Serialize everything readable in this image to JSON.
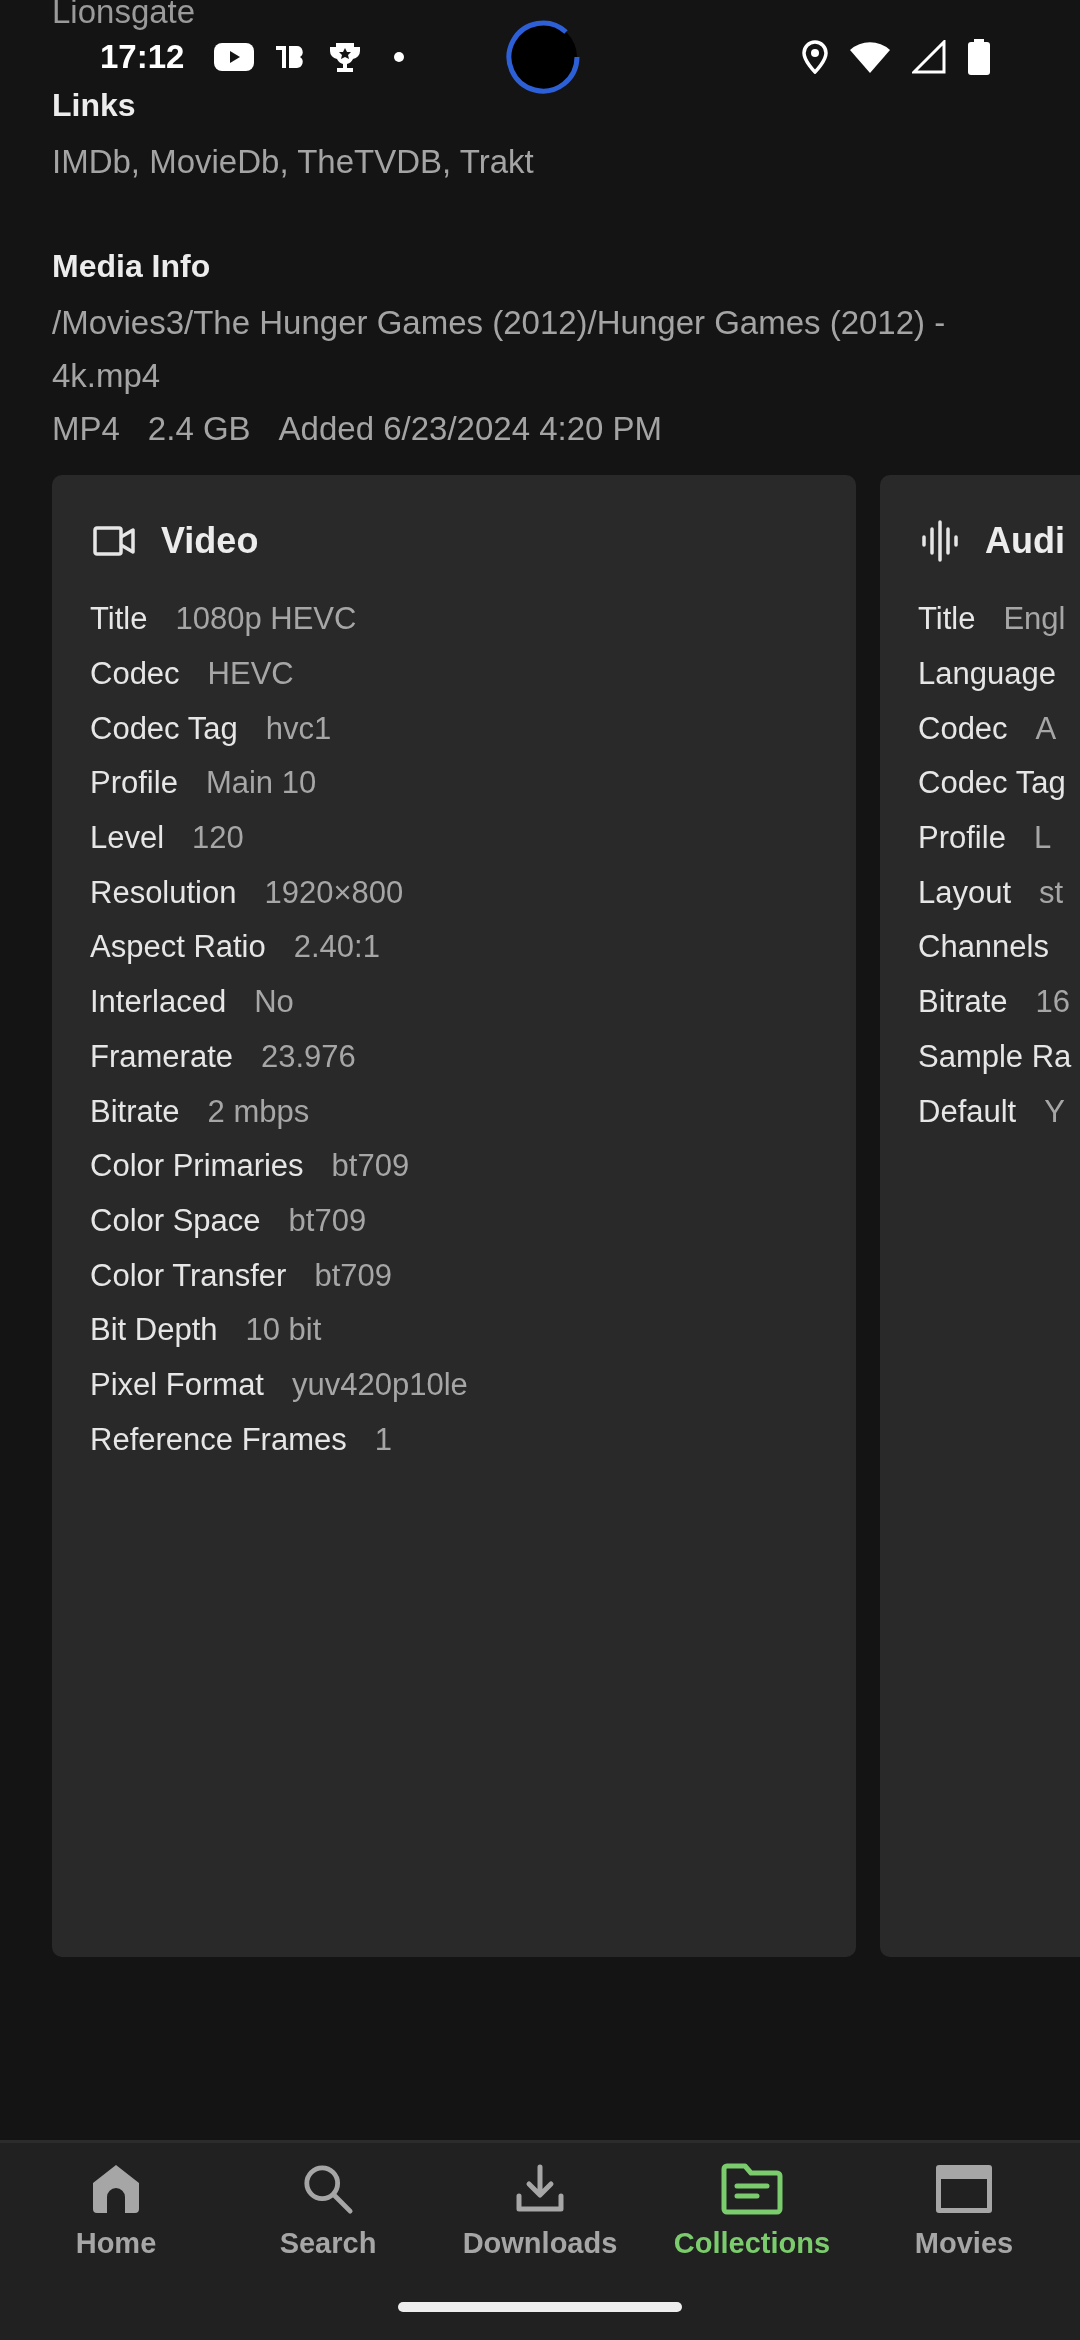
{
  "status_bar": {
    "time": "17:12"
  },
  "studio_text": "Lionsgate",
  "links": {
    "heading": "Links",
    "text": "IMDb, MovieDb, TheTVDB, Trakt"
  },
  "media_info": {
    "heading": "Media Info",
    "path": "/Movies3/The Hunger Games (2012)/Hunger Games (2012) - 4k.mp4",
    "meta": [
      "MP4",
      "2.4 GB",
      "Added 6/23/2024 4:20 PM"
    ]
  },
  "streams": [
    {
      "kind": "video",
      "title": "Video",
      "rows": [
        {
          "label": "Title",
          "value": "1080p HEVC"
        },
        {
          "label": "Codec",
          "value": "HEVC"
        },
        {
          "label": "Codec Tag",
          "value": "hvc1"
        },
        {
          "label": "Profile",
          "value": "Main 10"
        },
        {
          "label": "Level",
          "value": "120"
        },
        {
          "label": "Resolution",
          "value": "1920×800"
        },
        {
          "label": "Aspect Ratio",
          "value": "2.40:1"
        },
        {
          "label": "Interlaced",
          "value": "No"
        },
        {
          "label": "Framerate",
          "value": "23.976"
        },
        {
          "label": "Bitrate",
          "value": "2 mbps"
        },
        {
          "label": "Color Primaries",
          "value": "bt709"
        },
        {
          "label": "Color Space",
          "value": "bt709"
        },
        {
          "label": "Color Transfer",
          "value": "bt709"
        },
        {
          "label": "Bit Depth",
          "value": "10 bit"
        },
        {
          "label": "Pixel Format",
          "value": "yuv420p10le"
        },
        {
          "label": "Reference Frames",
          "value": "1"
        }
      ]
    },
    {
      "kind": "audio",
      "title": "Audi",
      "rows": [
        {
          "label": "Title",
          "value": "Engl"
        },
        {
          "label": "Language"
        },
        {
          "label": "Codec",
          "value": "A"
        },
        {
          "label": "Codec Tag"
        },
        {
          "label": "Profile",
          "value": "L"
        },
        {
          "label": "Layout",
          "value": "st"
        },
        {
          "label": "Channels"
        },
        {
          "label": "Bitrate",
          "value": "16"
        },
        {
          "label": "Sample Ra"
        },
        {
          "label": "Default",
          "value": "Y"
        }
      ]
    }
  ],
  "nav": [
    {
      "kind": "home",
      "label": "Home",
      "selected": false
    },
    {
      "kind": "search",
      "label": "Search",
      "selected": false
    },
    {
      "kind": "downloads",
      "label": "Downloads",
      "selected": false
    },
    {
      "kind": "collections",
      "label": "Collections",
      "selected": true
    },
    {
      "kind": "movies",
      "label": "Movies",
      "selected": false
    }
  ]
}
